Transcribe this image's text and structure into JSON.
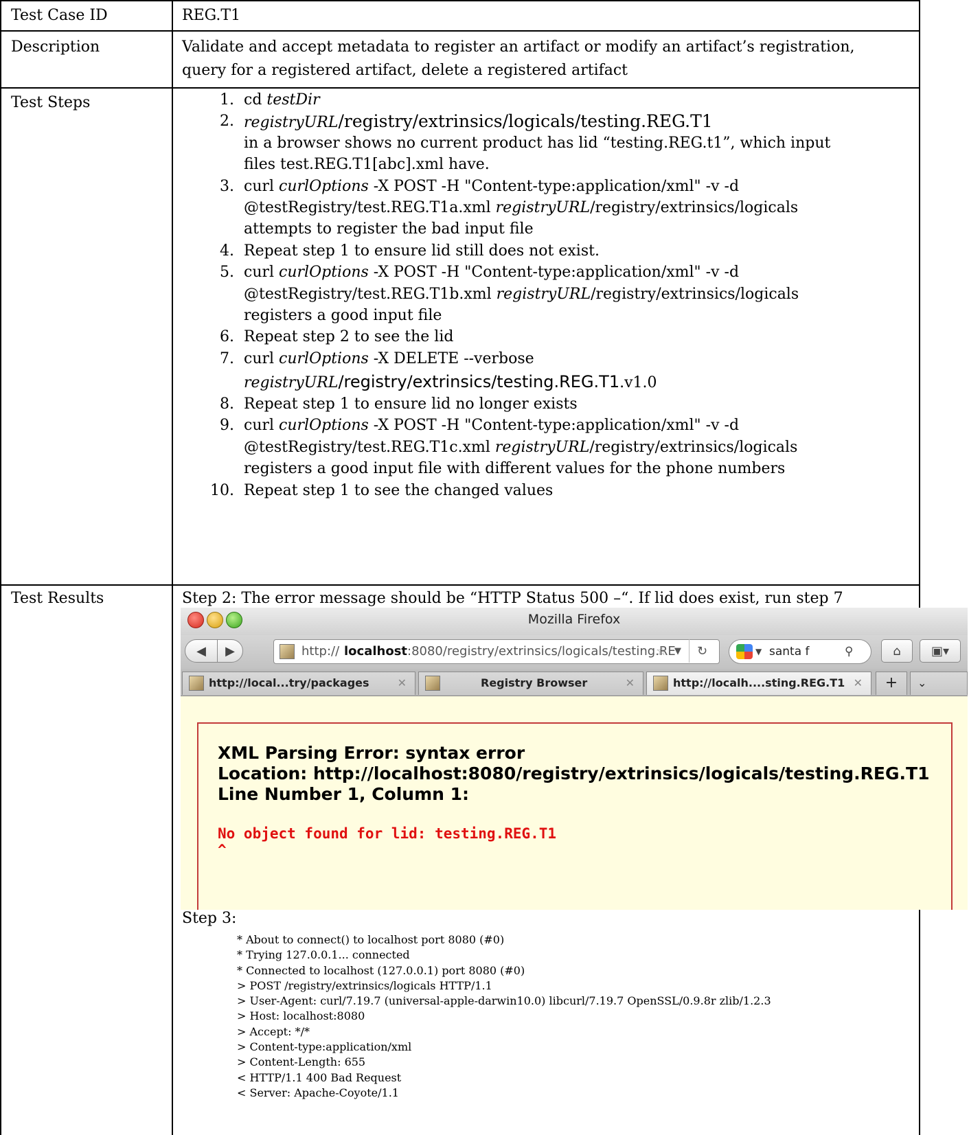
{
  "rows": {
    "id": {
      "label": "Test Case ID",
      "value": "REG.T1"
    },
    "description": {
      "label": "Description",
      "line1": "Validate and accept metadata to register an artifact or modify an artifact’s registration,",
      "line2": "query for a registered artifact, delete a registered artifact"
    },
    "steps": {
      "label": "Test Steps"
    },
    "results": {
      "label": "Test Results"
    }
  },
  "steps": {
    "s1": {
      "num": "1.",
      "plain": "cd ",
      "ital": "testDir"
    },
    "s2": {
      "num": "2.",
      "a_ital": "registryURL",
      "a_plain": "/registry/extrinsics/logicals/testing.REG.T1",
      "b": "in a browser shows no current product has lid “testing.REG.t1”, which input",
      "c": "files test.REG.T1[abc].xml have."
    },
    "s3": {
      "num": "3.",
      "a_pre": "curl  ",
      "a_ital": "curlOptions",
      "a_post": " -X POST -H \"Content-type:application/xml\" -v -d",
      "b_pre": "@testRegistry/test.REG.T1a.xml ",
      "b_ital": "registryURL",
      "b_post": "/registry/extrinsics/logicals",
      "c": "attempts to register the bad input file"
    },
    "s4": {
      "num": "4.",
      "text": "Repeat step 1 to ensure lid still does not exist."
    },
    "s5": {
      "num": "5.",
      "a_pre": "curl  ",
      "a_ital": "curlOptions",
      "a_post": " -X POST -H \"Content-type:application/xml\" -v -d",
      "b_pre": "@testRegistry/test.REG.T1b.xml ",
      "b_ital": "registryURL",
      "b_post": "/registry/extrinsics/logicals",
      "c": "registers a good input file"
    },
    "s6": {
      "num": "6.",
      "text": "Repeat step 2 to see the lid"
    },
    "s7": {
      "num": "7.",
      "a_pre": "curl  ",
      "a_ital": "curlOptions",
      "a_post": " -X DELETE --verbose",
      "b_ital": "registryURL",
      "b_big": "/registry/extrinsics/testing.REG.T1",
      "b_post": ".v1.0"
    },
    "s8": {
      "num": "8.",
      "text": "Repeat step 1 to ensure lid no longer exists"
    },
    "s9": {
      "num": "9.",
      "a_pre": "curl  ",
      "a_ital": "curlOptions",
      "a_post": " -X POST -H \"Content-type:application/xml\" -v -d",
      "b_pre": "@testRegistry/test.REG.T1c.xml ",
      "b_ital": "registryURL",
      "b_post": "/registry/extrinsics/logicals",
      "c": "registers a good input file with different values for the phone numbers"
    },
    "s10": {
      "num": "10.",
      "text": "Repeat step 1 to see the changed values"
    }
  },
  "results": {
    "step2": "Step 2: The error message should be “HTTP Status 500 –“. If lid does exist, run step 7",
    "step3": "Step 3:"
  },
  "browser": {
    "window_title": "Mozilla Firefox",
    "url_prefix": "http://",
    "url_host": "localhost",
    "url_rest": ":8080/registry/extrinsics/logicals/testing.RE",
    "search_text": "santa f",
    "tabs": [
      {
        "label": "http://local...try/packages"
      },
      {
        "label": "Registry Browser"
      },
      {
        "label": "http://localh....sting.REG.T1"
      }
    ],
    "error_title": "XML Parsing Error: syntax error",
    "error_location": "Location: http://localhost:8080/registry/extrinsics/logicals/testing.REG.T1",
    "error_line": "Line Number 1, Column 1:",
    "error_message": "No object found for lid: testing.REG.T1",
    "error_caret": "^",
    "icons": {
      "close_light": "red",
      "minimize_light": "yellow",
      "zoom_light": "green"
    },
    "colors": {
      "error_text": "#e01010",
      "page_background": "#fffde0"
    }
  },
  "log": [
    "* About to connect() to localhost port 8080 (#0)",
    "*   Trying 127.0.0.1... connected",
    "* Connected to localhost (127.0.0.1) port 8080 (#0)",
    "> POST /registry/extrinsics/logicals HTTP/1.1",
    "> User-Agent: curl/7.19.7 (universal-apple-darwin10.0) libcurl/7.19.7 OpenSSL/0.9.8r zlib/1.2.3",
    "> Host: localhost:8080",
    "> Accept: */*",
    "> Content-type:application/xml",
    "> Content-Length: 655",
    "< HTTP/1.1 400 Bad Request",
    "< Server: Apache-Coyote/1.1"
  ]
}
